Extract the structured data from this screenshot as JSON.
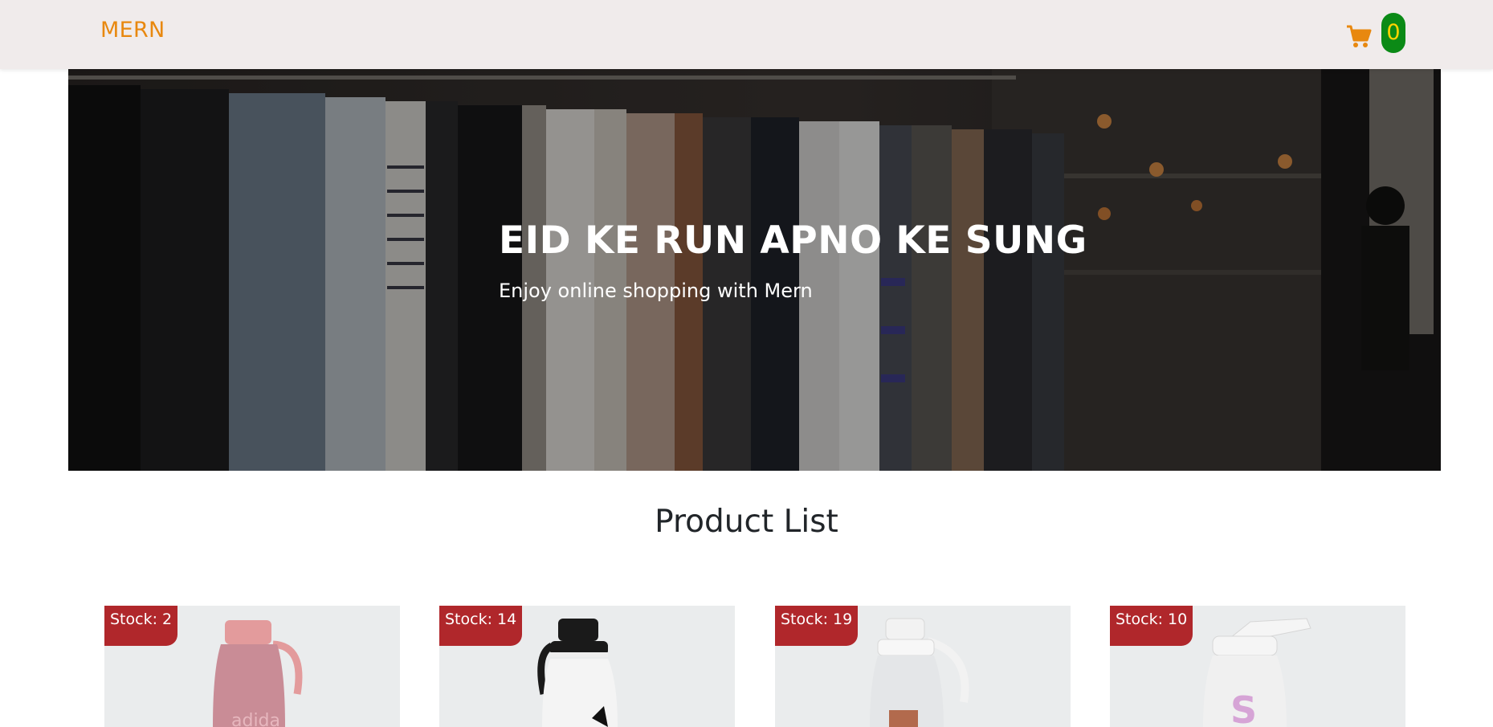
{
  "navbar": {
    "brand": "MERN",
    "cart_icon": "shopping-cart-icon",
    "cart_count": "0",
    "colors": {
      "background": "#f0ebeb",
      "brand": "#e8880f",
      "badge_bg": "#0b8a16",
      "badge_text": "#ffd400"
    }
  },
  "hero": {
    "title": "EID KE RUN APNO KE SUNG",
    "subtitle": "Enjoy online shopping with Mern"
  },
  "products_section": {
    "title": "Product List",
    "products": [
      {
        "stock": "Stock: 2",
        "image": "pink-water-bottle"
      },
      {
        "stock": "Stock: 14",
        "image": "white-black-cap-water-bottle"
      },
      {
        "stock": "Stock: 19",
        "image": "white-water-bottle"
      },
      {
        "stock": "Stock: 10",
        "image": "white-purple-water-bottle"
      }
    ],
    "colors": {
      "stock_badge": "#b0272b",
      "card_bg": "#eaeced"
    }
  }
}
